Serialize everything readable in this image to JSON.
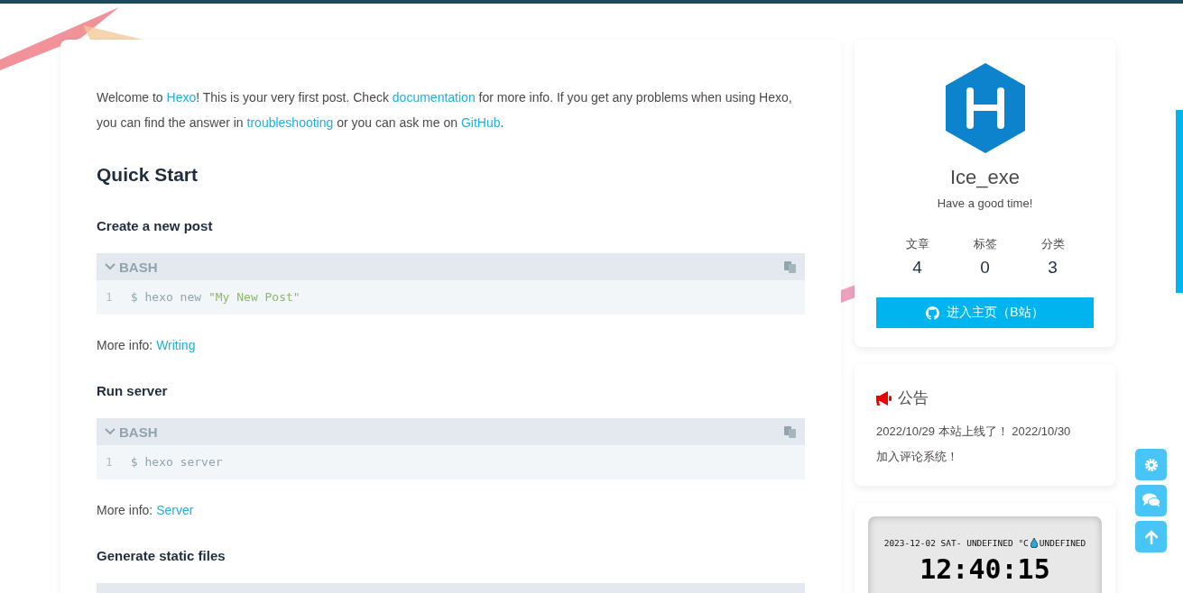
{
  "post": {
    "blocks": [
      {
        "kind": "paragraph",
        "segments": [
          {
            "text": "Welcome to ",
            "link": false
          },
          {
            "text": "Hexo",
            "link": true
          },
          {
            "text": "! This is your very first post. Check ",
            "link": false
          },
          {
            "text": "documentation",
            "link": true
          },
          {
            "text": " for more info. If you get any problems when using Hexo, you can find the answer in ",
            "link": false
          },
          {
            "text": "troubleshooting",
            "link": true
          },
          {
            "text": " or you can ask me on ",
            "link": false
          },
          {
            "text": "GitHub",
            "link": true
          },
          {
            "text": ".",
            "link": false
          }
        ]
      },
      {
        "kind": "heading2",
        "text": "Quick Start"
      },
      {
        "kind": "heading3",
        "text": "Create a new post"
      },
      {
        "kind": "code",
        "language": "BASH",
        "lines": [
          {
            "number": "1",
            "tokens": [
              {
                "kind": "plain",
                "text": "$ hexo new "
              },
              {
                "kind": "string",
                "text": "\"My New Post\""
              }
            ]
          }
        ]
      },
      {
        "kind": "paragraph",
        "segments": [
          {
            "text": "More info: ",
            "link": false
          },
          {
            "text": "Writing",
            "link": true
          }
        ]
      },
      {
        "kind": "heading3",
        "text": "Run server"
      },
      {
        "kind": "code",
        "language": "BASH",
        "lines": [
          {
            "number": "1",
            "tokens": [
              {
                "kind": "plain",
                "text": "$ hexo server"
              }
            ]
          }
        ]
      },
      {
        "kind": "paragraph",
        "segments": [
          {
            "text": "More info: ",
            "link": false
          },
          {
            "text": "Server",
            "link": true
          }
        ]
      },
      {
        "kind": "heading3",
        "text": "Generate static files"
      },
      {
        "kind": "code"
      }
    ]
  },
  "profile": {
    "name": "Ice_exe",
    "motto": "Have a good time!",
    "stats": [
      {
        "label": "文章",
        "value": "4"
      },
      {
        "label": "标签",
        "value": "0"
      },
      {
        "label": "分类",
        "value": "3"
      }
    ],
    "button": "进入主页（B站）"
  },
  "notice": {
    "title": "公告",
    "text": "2022/10/29 本站上线了！  2022/10/30 加入评论系统！"
  },
  "clock": {
    "date": "2023-12-02 SAT- UNDEFINED °C",
    "humidity": "UNDEFINED",
    "time": "12:40:15"
  }
}
